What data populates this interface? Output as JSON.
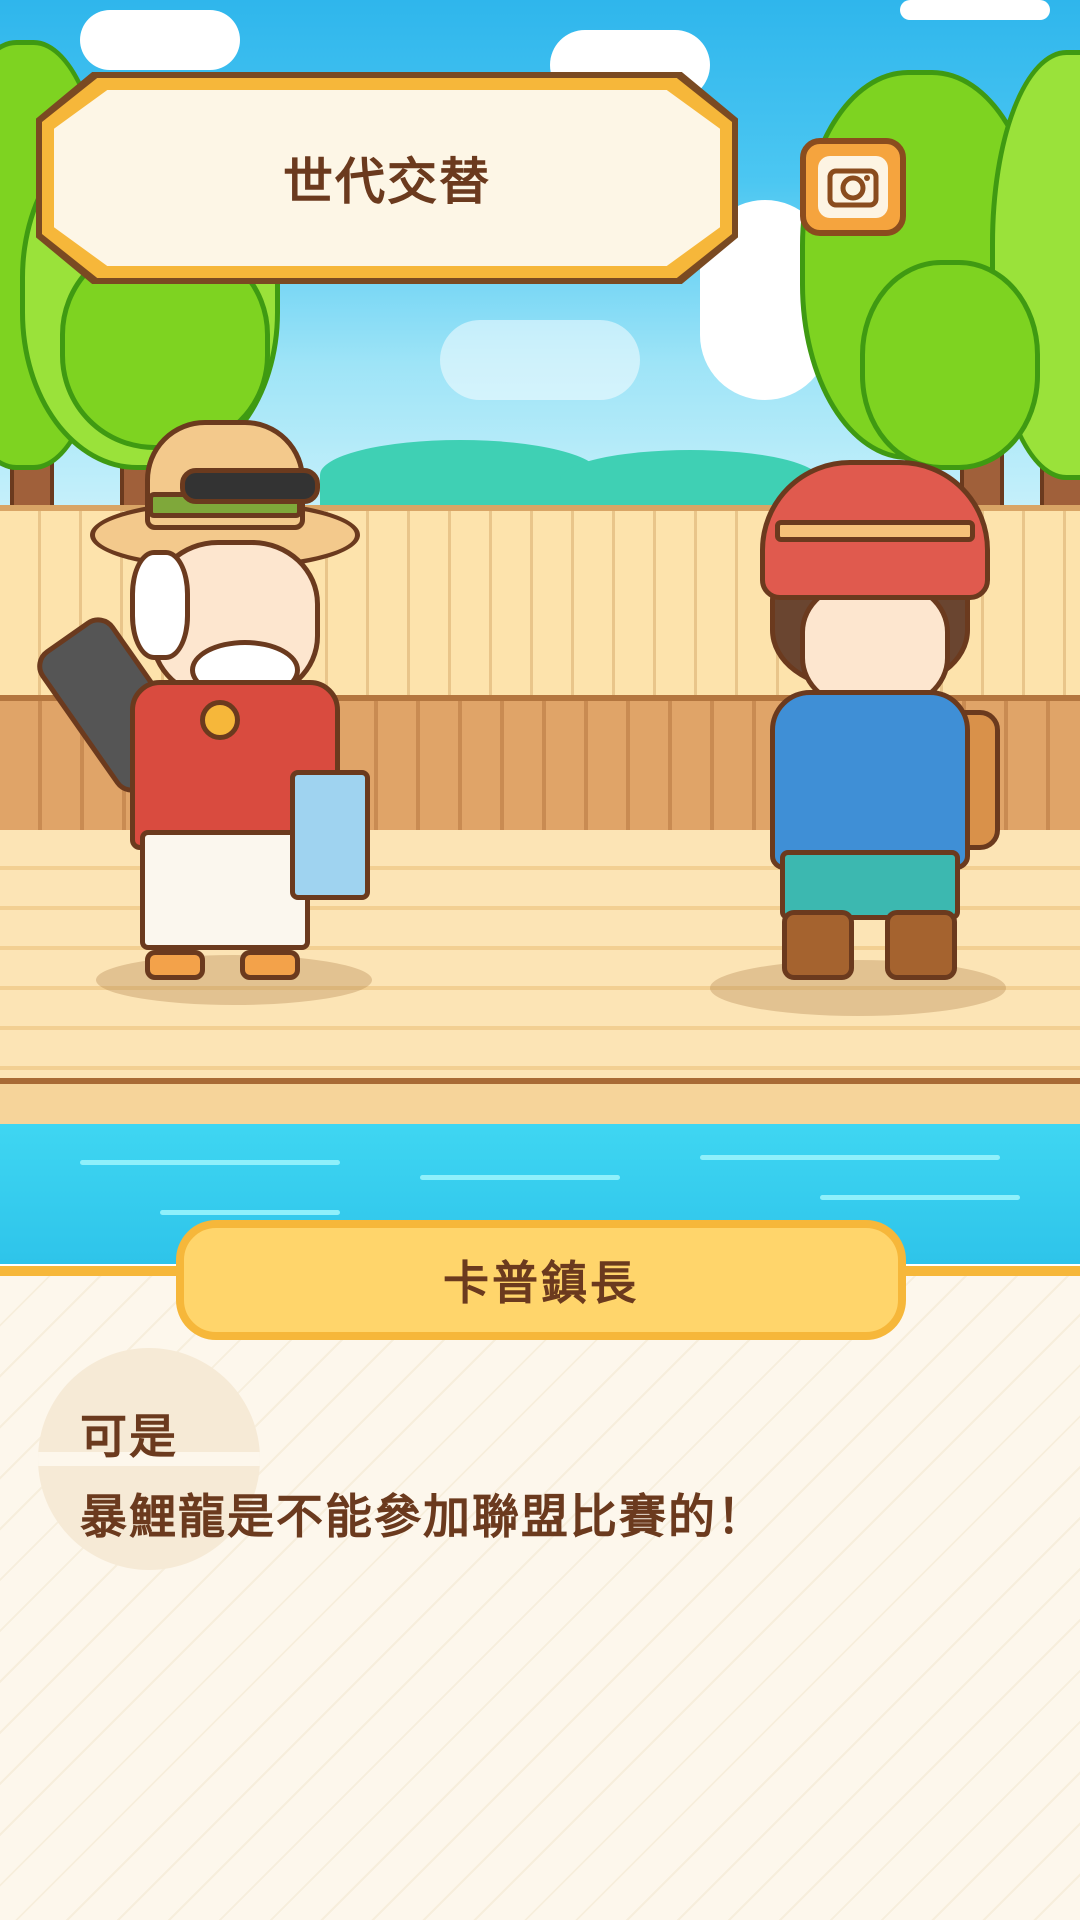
{
  "scene": {
    "title": "世代交替",
    "camera_button_icon": "camera-icon"
  },
  "dialog": {
    "speaker": "卡普鎮長",
    "lines": [
      "可是",
      "暴鯉龍是不能參加聯盟比賽的！"
    ]
  },
  "colors": {
    "accent": "#f6b73a",
    "text_brown": "#6b3a1e",
    "sky": "#2fb6ec",
    "pool": "#3fd6f2"
  }
}
